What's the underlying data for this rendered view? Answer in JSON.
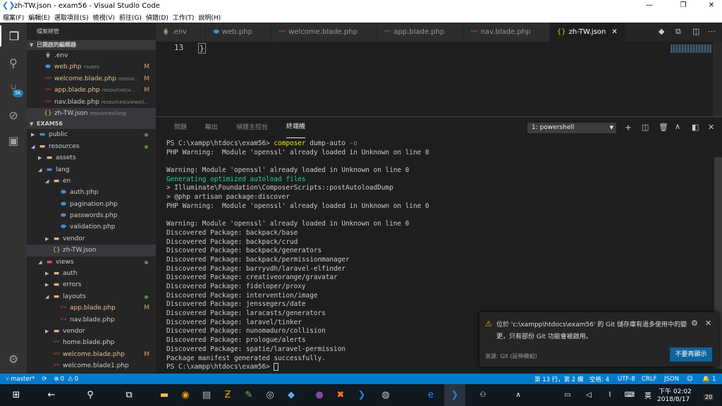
{
  "window": {
    "title": "zh-TW.json - exam56 - Visual Studio Code"
  },
  "menu": [
    "檔案(F)",
    "編輯(E)",
    "選取項目(S)",
    "檢視(V)",
    "前往(G)",
    "偵錯(D)",
    "工作(T)",
    "說明(H)"
  ],
  "sidebar": {
    "header": "檔案總管",
    "open_editors_title": "已開啟的編輯器",
    "open_editors": [
      {
        "name": ".env",
        "desc": "",
        "status": ""
      },
      {
        "name": "web.php",
        "desc": "routes",
        "status": "M"
      },
      {
        "name": "welcome.blade.php",
        "desc": "resour...",
        "status": "M"
      },
      {
        "name": "app.blade.php",
        "desc": "resources\\v...",
        "status": "M"
      },
      {
        "name": "nav.blade.php",
        "desc": "resources\\views\\l...",
        "status": ""
      },
      {
        "name": "zh-TW.json",
        "desc": "resources\\lang",
        "status": ""
      }
    ],
    "project_title": "EXAM56",
    "tree": [
      {
        "name": "public",
        "depth": 1,
        "type": "folder",
        "open": false,
        "status": "dot"
      },
      {
        "name": "resources",
        "depth": 1,
        "type": "folder",
        "open": true,
        "status": "dot"
      },
      {
        "name": "assets",
        "depth": 2,
        "type": "folder",
        "open": false,
        "status": ""
      },
      {
        "name": "lang",
        "depth": 2,
        "type": "folder",
        "open": true,
        "status": ""
      },
      {
        "name": "en",
        "depth": 3,
        "type": "folder",
        "open": true,
        "status": ""
      },
      {
        "name": "auth.php",
        "depth": 4,
        "type": "php",
        "status": ""
      },
      {
        "name": "pagination.php",
        "depth": 4,
        "type": "php",
        "status": ""
      },
      {
        "name": "passwords.php",
        "depth": 4,
        "type": "php",
        "status": ""
      },
      {
        "name": "validation.php",
        "depth": 4,
        "type": "php",
        "status": ""
      },
      {
        "name": "vendor",
        "depth": 3,
        "type": "folder",
        "open": false,
        "status": ""
      },
      {
        "name": "zh-TW.json",
        "depth": 3,
        "type": "json",
        "status": "",
        "selected": true
      },
      {
        "name": "views",
        "depth": 2,
        "type": "folder",
        "open": true,
        "status": "dot"
      },
      {
        "name": "auth",
        "depth": 3,
        "type": "folder",
        "open": false,
        "status": ""
      },
      {
        "name": "errors",
        "depth": 3,
        "type": "folder",
        "open": false,
        "status": ""
      },
      {
        "name": "layouts",
        "depth": 3,
        "type": "folder",
        "open": true,
        "status": "dot"
      },
      {
        "name": "app.blade.php",
        "depth": 4,
        "type": "blade",
        "status": "M"
      },
      {
        "name": "nav.blade.php",
        "depth": 4,
        "type": "blade",
        "status": ""
      },
      {
        "name": "vendor",
        "depth": 3,
        "type": "folder",
        "open": false,
        "status": ""
      },
      {
        "name": "home.blade.php",
        "depth": 3,
        "type": "blade",
        "status": ""
      },
      {
        "name": "welcome.blade.php",
        "depth": 3,
        "type": "blade",
        "status": "M"
      },
      {
        "name": "welcome.blade1.php",
        "depth": 3,
        "type": "blade",
        "status": ""
      }
    ]
  },
  "tabs": [
    {
      "name": ".env",
      "type": "env",
      "active": false
    },
    {
      "name": "web.php",
      "type": "php",
      "active": false
    },
    {
      "name": "welcome.blade.php",
      "type": "blade",
      "active": false
    },
    {
      "name": "app.blade.php",
      "type": "blade",
      "active": false
    },
    {
      "name": "nav.blade.php",
      "type": "blade",
      "active": false
    },
    {
      "name": "zh-TW.json",
      "type": "json",
      "active": true
    }
  ],
  "editor": {
    "line_number": "13",
    "line_text": "}"
  },
  "panel": {
    "tabs": [
      "問題",
      "輸出",
      "偵錯主控台",
      "終端機"
    ],
    "active_tab": "終端機",
    "terminal_select": "1: powershell",
    "lines": [
      "PS C:\\xampp\\htdocs\\exam56> composer dump-auto -o",
      "PHP Warning:  Module 'openssl' already loaded in Unknown on line 0",
      "",
      "Warning: Module 'openssl' already loaded in Unknown on line 0",
      "Generating optimized autoload files",
      "> Illuminate\\Foundation\\ComposerScripts::postAutoloadDump",
      "> @php artisan package:discover",
      "PHP Warning:  Module 'openssl' already loaded in Unknown on line 0",
      "",
      "Warning: Module 'openssl' already loaded in Unknown on line 0",
      "Discovered Package: backpack/base",
      "Discovered Package: backpack/crud",
      "Discovered Package: backpack/generators",
      "Discovered Package: backpack/permissionmanager",
      "Discovered Package: barryvdh/laravel-elfinder",
      "Discovered Package: creativeorange/gravatar",
      "Discovered Package: fideloper/proxy",
      "Discovered Package: intervention/image",
      "Discovered Package: jenssegers/date",
      "Discovered Package: laracasts/generators",
      "Discovered Package: laravel/tinker",
      "Discovered Package: nunomaduro/collision",
      "Discovered Package: prologue/alerts",
      "Discovered Package: spatie/laravel-permission",
      "Package manifest generated successfully.",
      "PS C:\\xampp\\htdocs\\exam56> "
    ]
  },
  "notification": {
    "message_line1": "位於 'c:\\xampp\\htdocs\\exam56' 的 Git 儲存庫有過多使用中的變",
    "message_line2": "更，只有部份 Git 功能會被啟用。",
    "source": "來源: Git (延伸模組)",
    "button": "不要再顯示"
  },
  "statusbar": {
    "branch": "master*",
    "errors": "0",
    "warnings": "0",
    "position": "第 13 行，第 2 欄",
    "spaces": "空格: 4",
    "encoding": "UTF-8",
    "eol": "CRLF",
    "language": "JSON",
    "notifications": "1"
  },
  "taskbar": {
    "ime": "英",
    "time": "下午 02:02",
    "date": "2018/8/17",
    "badge": "20"
  },
  "activity": {
    "scm_badge": "5k"
  },
  "colors": {
    "accent": "#007acc",
    "modified": "#e2c08d",
    "green": "#23d18b"
  }
}
